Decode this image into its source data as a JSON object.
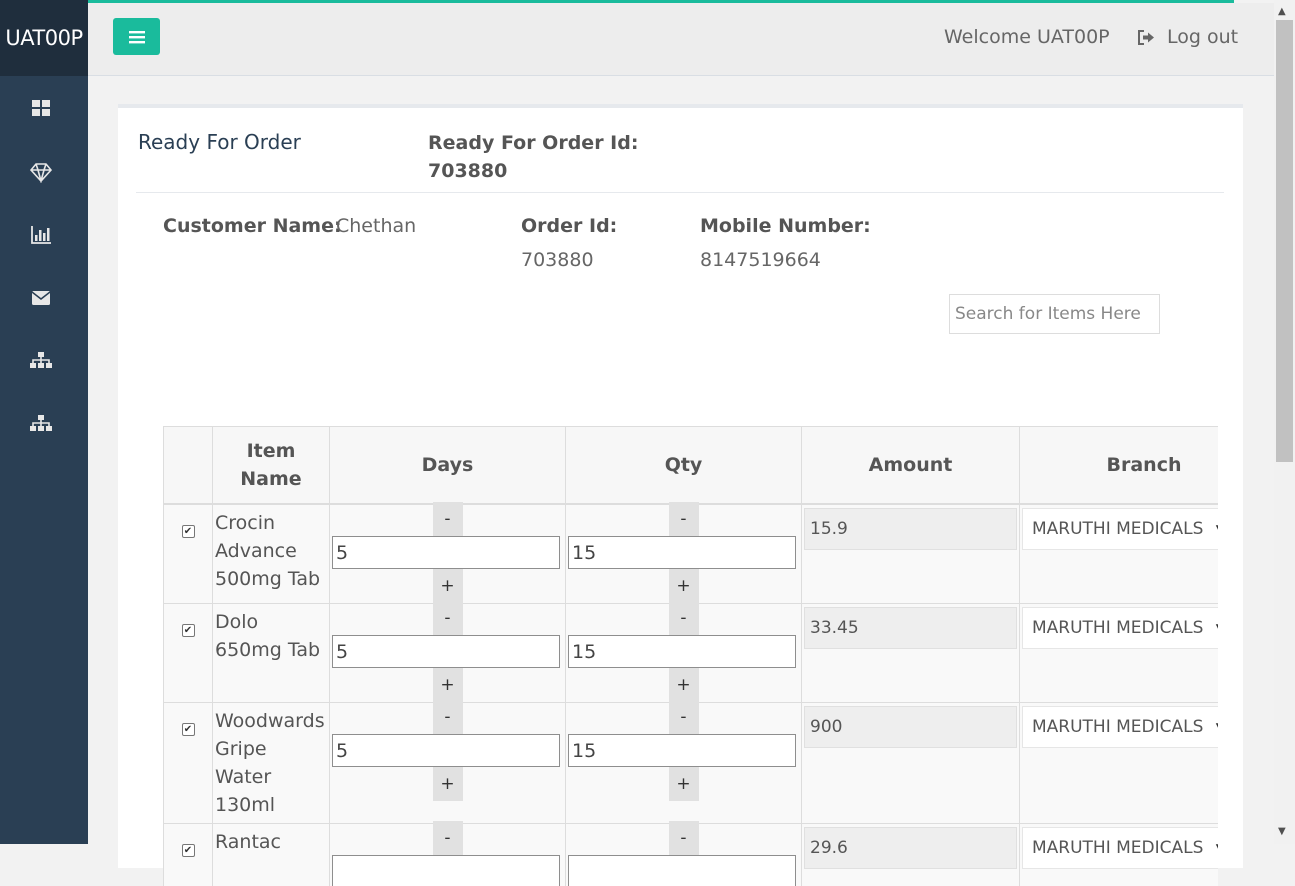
{
  "app": {
    "brand": "UAT00P"
  },
  "colors": {
    "accent": "#1abb9c",
    "sidebar": "#2a3f54"
  },
  "sidebar": {
    "icons": [
      "dashboard-icon",
      "diamond-icon",
      "bar-chart-icon",
      "envelope-icon",
      "sitemap-icon",
      "sitemap-icon"
    ]
  },
  "header": {
    "welcome": "Welcome UAT00P",
    "logout_label": "Log out"
  },
  "panel": {
    "title": "Ready For Order",
    "ready_id_label": "Ready For Order Id:",
    "ready_id_value": "703880"
  },
  "customer": {
    "name_label": "Customer Name:",
    "name_value": "Chethan",
    "order_id_label": "Order Id:",
    "order_id_value": "703880",
    "mobile_label": "Mobile Number:",
    "mobile_value": "8147519664"
  },
  "search": {
    "placeholder": "Search for Items Here"
  },
  "table": {
    "headers": {
      "item_name": "Item Name",
      "days": "Days",
      "qty": "Qty",
      "amount": "Amount",
      "branch": "Branch"
    },
    "minus_label": "-",
    "plus_label": "+",
    "rows": [
      {
        "checked": true,
        "name": "Crocin Advance 500mg Tab",
        "days": "5",
        "qty": "15",
        "amount": "15.9",
        "branch": "MARUTHI MEDICALS"
      },
      {
        "checked": true,
        "name": "Dolo 650mg Tab",
        "days": "5",
        "qty": "15",
        "amount": "33.45",
        "branch": "MARUTHI MEDICALS"
      },
      {
        "checked": true,
        "name": "Woodwards Gripe Water 130ml",
        "days": "5",
        "qty": "15",
        "amount": "900",
        "branch": "MARUTHI MEDICALS"
      },
      {
        "checked": true,
        "name": "Rantac",
        "days": "",
        "qty": "",
        "amount": "29.6",
        "branch": "MARUTHI MEDICALS"
      }
    ]
  }
}
